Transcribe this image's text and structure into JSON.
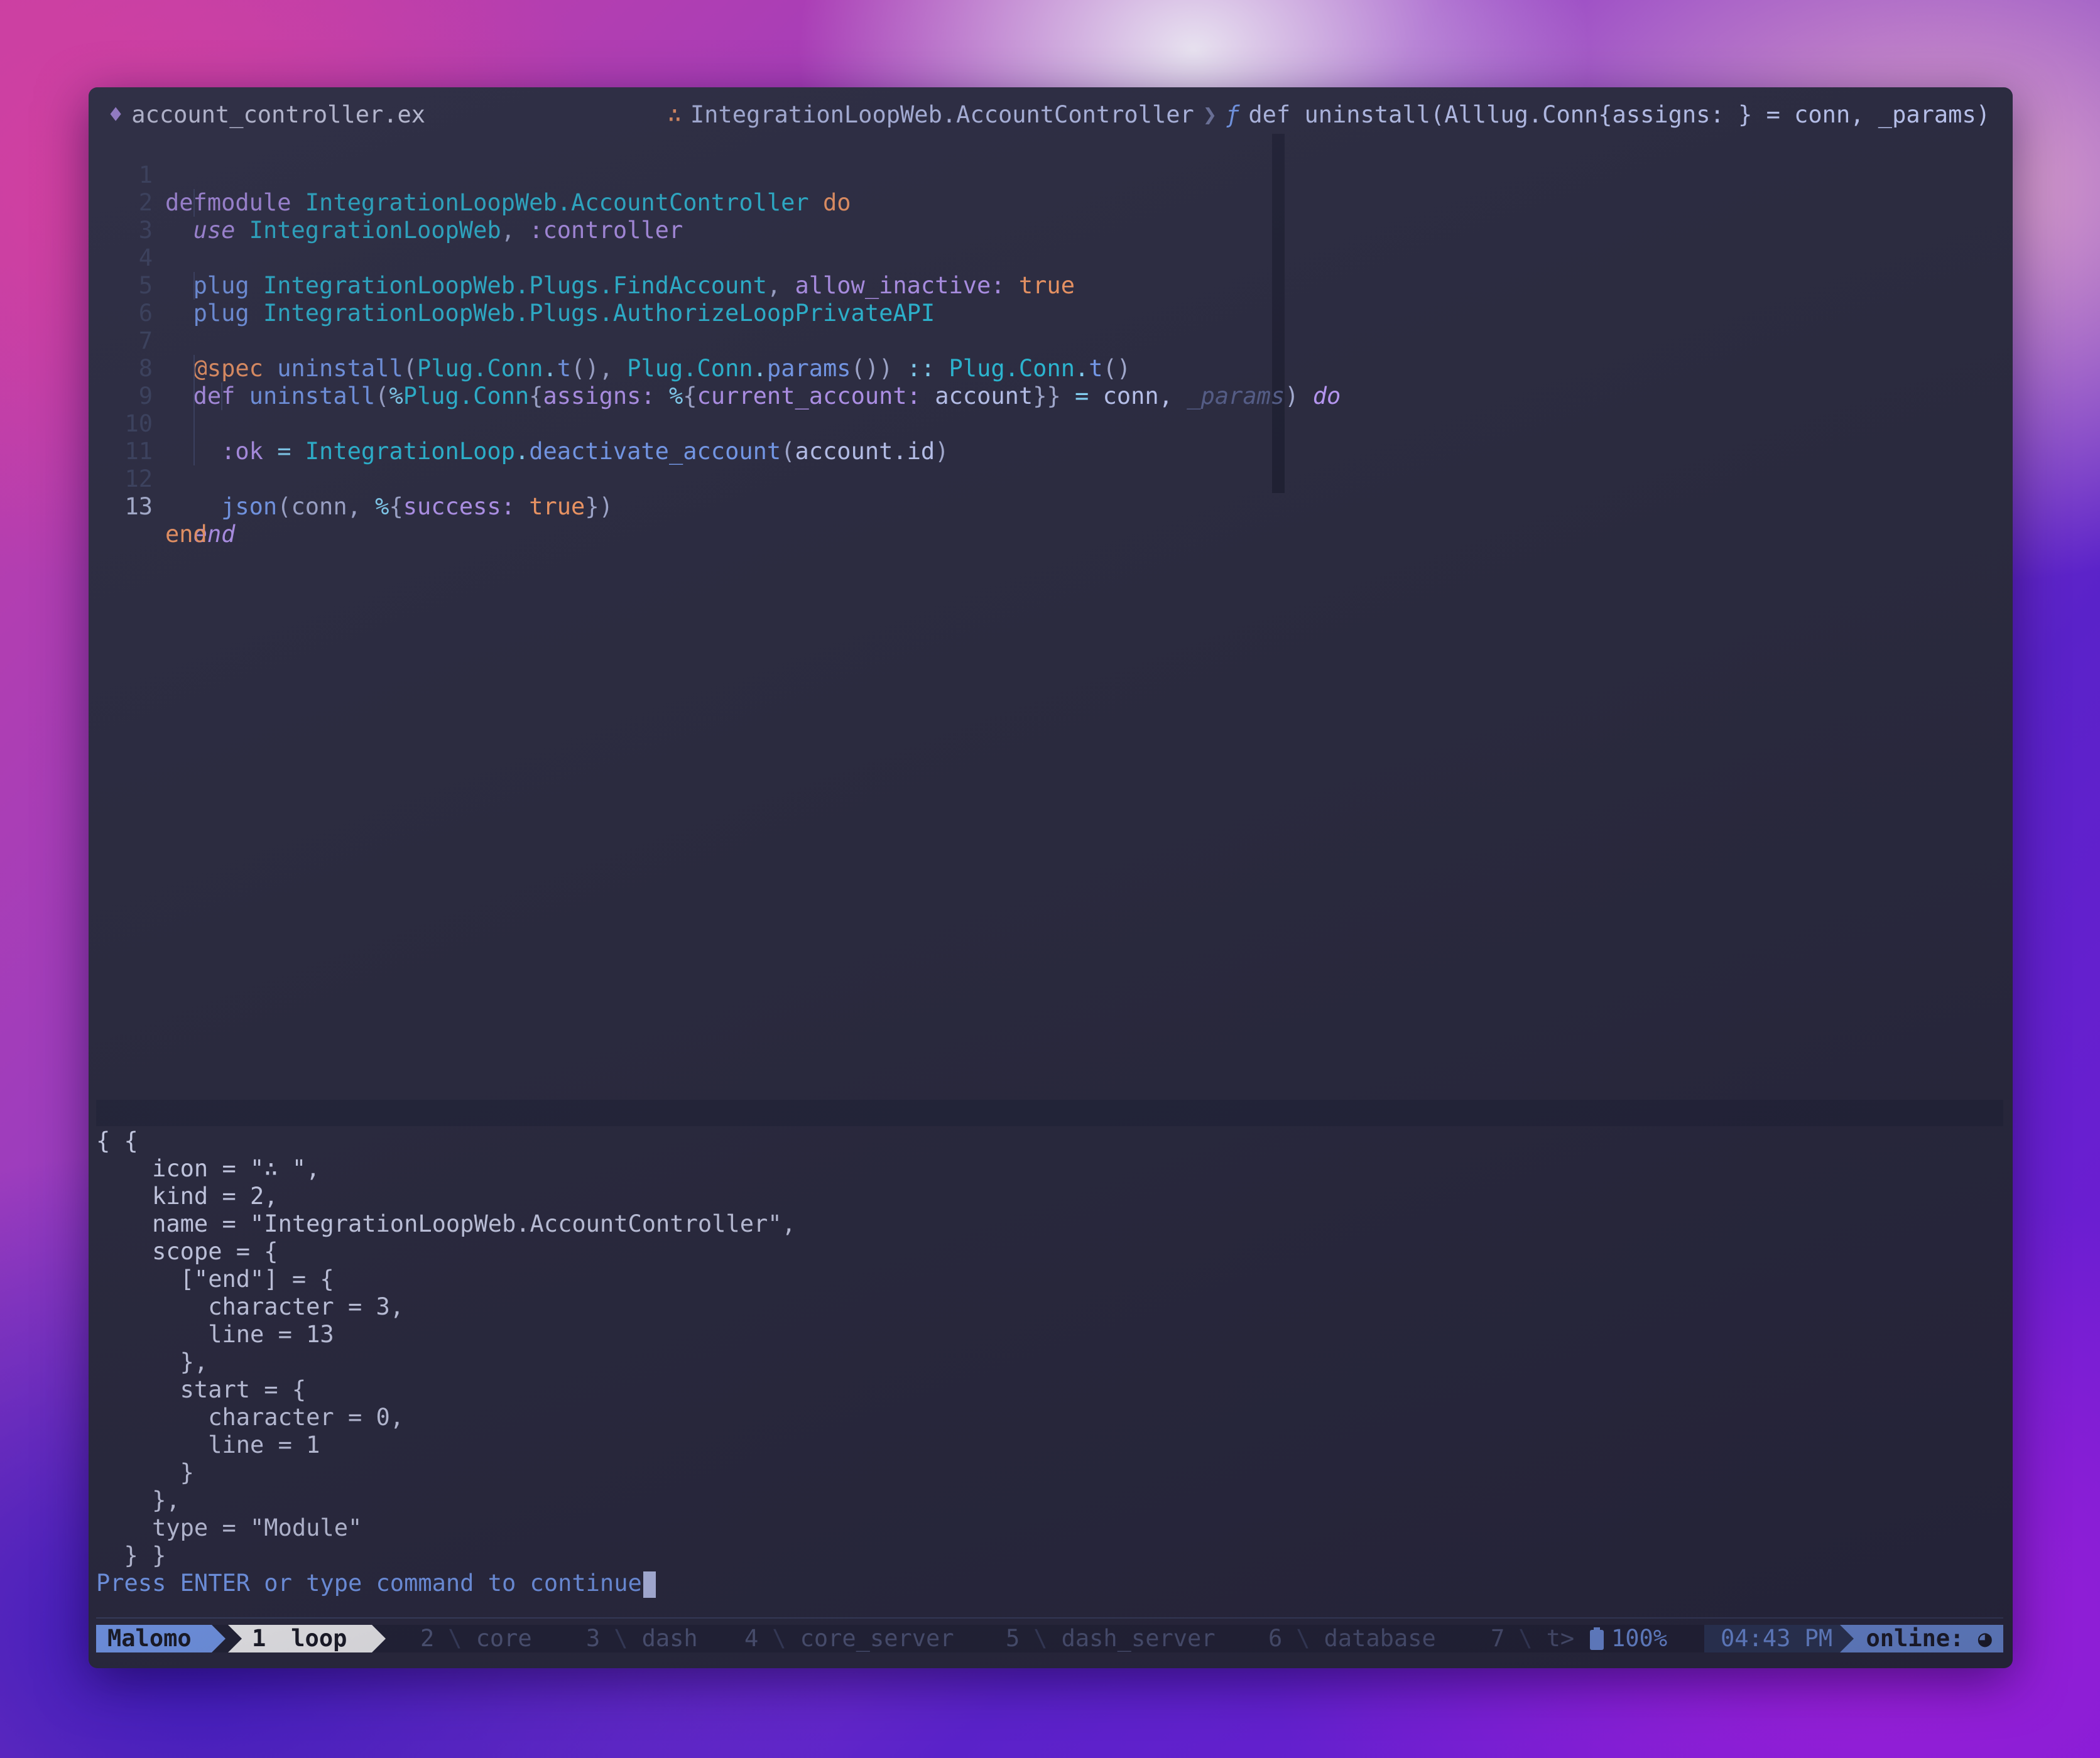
{
  "tabline": {
    "file_icon": "♦",
    "filename": "account_controller.ex",
    "module_icon": "∴",
    "module": "IntegrationLoopWeb.AccountController",
    "separator": "❯",
    "function_icon": "ƒ",
    "function_sig": "def uninstall(Alllug.Conn{assigns: } = conn, _params)"
  },
  "code": {
    "line_numbers": [
      "1",
      "2",
      "3",
      "4",
      "5",
      "6",
      "7",
      "8",
      "9",
      "10",
      "11",
      "12",
      "13"
    ],
    "l1": {
      "kw": "defmodule",
      "mod": "IntegrationLoopWeb.AccountController",
      "do": "do"
    },
    "l2": {
      "kw": "use",
      "mod": "IntegrationLoopWeb",
      "sep": ", ",
      "atom": ":controller"
    },
    "l4": {
      "kw": "plug",
      "mod": "IntegrationLoopWeb.Plugs.FindAccount",
      "sep": ", ",
      "key": "allow_inactive:",
      "val": "true"
    },
    "l5": {
      "kw": "plug",
      "mod": "IntegrationLoopWeb.Plugs.AuthorizeLoopPrivateAPI"
    },
    "l7": {
      "attr": "@spec",
      "fn": "uninstall",
      "p1": "(",
      "m1": "Plug.Conn",
      "d1": ".",
      "f1": "t",
      "p2": "(), ",
      "m2": "Plug.Conn",
      "d2": ".",
      "f2": "params",
      "p3": "()) ",
      "op": "::",
      "m3": "Plug.Conn",
      "d3": ".",
      "f3": "t",
      "p4": "()"
    },
    "l8": {
      "kw": "def",
      "fn": "uninstall",
      "p1": "(",
      "pct": "%",
      "mod": "Plug.Conn",
      "p2": "{",
      "key": "assigns:",
      "pct2": "%",
      "p3": "{",
      "key2": "current_account:",
      "var": "account",
      "p4": "}}",
      "eq": "=",
      "conn": "conn,",
      "unused": "_params",
      "p5": ")",
      "do": "do"
    },
    "l9": {
      "atom": ":ok",
      "eq": "=",
      "mod": "IntegrationLoop",
      "dot": ".",
      "fn": "deactivate_account",
      "p1": "(",
      "arg": "account.id",
      "p2": ")"
    },
    "l11": {
      "fn": "json",
      "p1": "(conn, ",
      "pct": "%",
      "p2": "{",
      "key": "success:",
      "val": "true",
      "p3": "})"
    },
    "l12": {
      "kw": "end"
    },
    "l13": {
      "kw": "end"
    }
  },
  "output": {
    "lines": [
      "{ {",
      "    icon = \"∴ \",",
      "    kind = 2,",
      "    name = \"IntegrationLoopWeb.AccountController\",",
      "    scope = {",
      "      [\"end\"] = {",
      "        character = 3,",
      "        line = 13",
      "      },",
      "      start = {",
      "        character = 0,",
      "        line = 1",
      "      }",
      "    },",
      "    type = \"Module\"",
      "  } }"
    ],
    "prompt": "Press ENTER or type command to continue"
  },
  "statusbar": {
    "session": "Malomo",
    "active_window": {
      "num": "1",
      "name": "loop"
    },
    "windows": [
      {
        "num": "2",
        "name": "core"
      },
      {
        "num": "3",
        "name": "dash"
      },
      {
        "num": "4",
        "name": "core_server"
      },
      {
        "num": "5",
        "name": "dash_server"
      },
      {
        "num": "6",
        "name": "database"
      },
      {
        "num": "7",
        "name": "t>"
      }
    ],
    "window_sep": "\\",
    "battery_icon": "battery-icon",
    "battery": "100%",
    "time": "04:43 PM",
    "online": "online: ◕"
  }
}
